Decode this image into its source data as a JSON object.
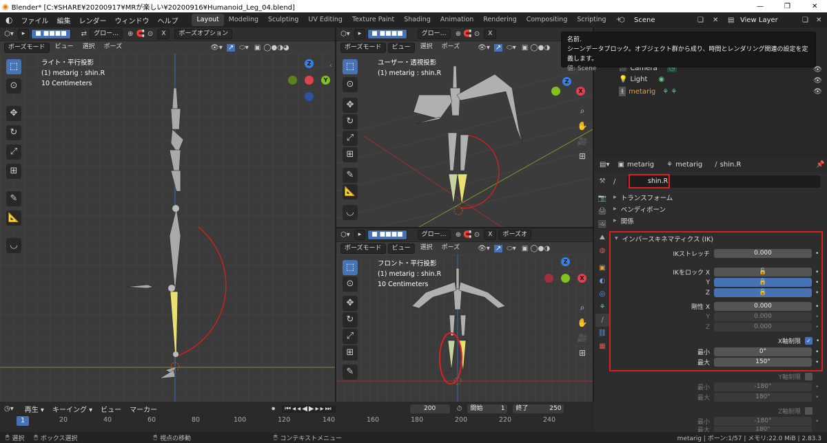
{
  "window": {
    "title": "Blender* [C:¥SHARE¥20200917¥MRが楽しい¥20200916¥Humanoid_Leg_04.blend]",
    "minimize": "—",
    "maximize": "❐",
    "close": "✕"
  },
  "menu": [
    "ファイル",
    "編集",
    "レンダー",
    "ウィンドウ",
    "ヘルプ"
  ],
  "workspaces": [
    "Layout",
    "Modeling",
    "Sculpting",
    "UV Editing",
    "Texture Paint",
    "Shading",
    "Animation",
    "Rendering",
    "Compositing",
    "Scripting"
  ],
  "scene": {
    "label": "Scene",
    "view_layer": "View Layer"
  },
  "tooltip": {
    "line1": "名前.",
    "line2": "シーンデータブロック。オブジェクト群から成り、時間とレンダリング関連の設定を定義します。",
    "line3": "値: Scene"
  },
  "outliner": {
    "items": [
      "Camera",
      "Light",
      "metarig"
    ]
  },
  "header": {
    "global": "グロー…",
    "pose_options": "ポーズオプション",
    "pose_mode": "ポーズモード",
    "view": "ビュー",
    "select": "選択",
    "pose": "ポーズ",
    "pose_options_short": "ポーズオ"
  },
  "viewports": {
    "left": {
      "line1": "ライト・平行投影",
      "line2": "(1) metarig : shin.R",
      "line3": "10 Centimeters"
    },
    "tr": {
      "line1": "ユーザー・透視投影",
      "line2": "(1) metarig : shin.R"
    },
    "br": {
      "line1": "フロント・平行投影",
      "line2": "(1) metarig : shin.R",
      "line3": "10 Centimeters"
    }
  },
  "axes": {
    "x": "X",
    "y": "Y",
    "z": "Z"
  },
  "props": {
    "breadcrumb": [
      "metarig",
      "metarig",
      "shin.R"
    ],
    "bone_name": "shin.R",
    "sections": [
      "トランスフォーム",
      "ベンディボーン",
      "関係"
    ],
    "ik_title": "インバースキネマティクス (IK)",
    "ik_stretch_label": "IKストレッチ",
    "ik_stretch": "0.000",
    "lock_label": "IKをロック X",
    "lock_y": "Y",
    "lock_z": "Z",
    "stiff_label": "剛性 X",
    "stiff_x": "0.000",
    "stiff_y_label": "Y",
    "stiff_y": "0.000",
    "stiff_z_label": "Z",
    "stiff_z": "0.000",
    "xlimit_label": "X軸制限",
    "min_label": "最小",
    "min_x": "0°",
    "max_label": "最大",
    "max_x": "150°",
    "ylimit_label": "Y軸制限",
    "min_y": "-180°",
    "max_y": "180°",
    "zlimit_label": "Z軸制限",
    "min_z": "-180°",
    "max_z": "180°"
  },
  "timeline": {
    "playback": "再生",
    "keying": "キーイング",
    "view": "ビュー",
    "marker": "マーカー",
    "current": "1",
    "frame": "200",
    "start_label": "開始",
    "start": "1",
    "end_label": "終了",
    "end": "250",
    "ticks": [
      "1",
      "20",
      "40",
      "60",
      "80",
      "100",
      "120",
      "140",
      "160",
      "180",
      "200",
      "220",
      "240"
    ]
  },
  "status": {
    "select": "選択",
    "box_select": "ボックス選択",
    "move_view": "視点の移動",
    "context_menu": "コンテキストメニュー",
    "info": "metarig | ボーン:1/57 | メモリ:22.0 MiB | 2.83.3"
  },
  "colors": {
    "accent": "#4772b3",
    "highlight": "#e02020",
    "bone_selected": "#e8e070",
    "x_axis": "#e04050",
    "y_axis": "#80c020",
    "z_axis": "#3a80e0"
  }
}
